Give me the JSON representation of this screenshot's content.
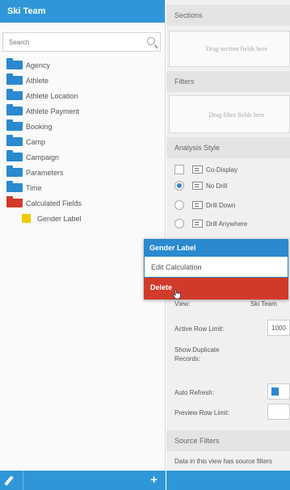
{
  "left_panel": {
    "title": "Ski Team",
    "search_placeholder": "Search",
    "tree": [
      {
        "label": "Agency",
        "kind": "folder"
      },
      {
        "label": "Athlete",
        "kind": "folder"
      },
      {
        "label": "Athlete Location",
        "kind": "folder"
      },
      {
        "label": "Athlete Payment",
        "kind": "folder"
      },
      {
        "label": "Booking",
        "kind": "folder"
      },
      {
        "label": "Camp",
        "kind": "folder"
      },
      {
        "label": "Campaign",
        "kind": "folder"
      },
      {
        "label": "Parameters",
        "kind": "folder"
      },
      {
        "label": "Time",
        "kind": "folder"
      },
      {
        "label": "Calculated Fields",
        "kind": "folder-red"
      },
      {
        "label": "Gender Label",
        "kind": "field"
      }
    ],
    "footer_plus": "+"
  },
  "right_panel": {
    "sections_header": "Sections",
    "sections_drop": "Drag section fields here",
    "filters_header": "Filters",
    "filters_drop": "Drag filter fields here",
    "analysis_header": "Analysis Style",
    "analysis_options": [
      {
        "label": "Co-Display",
        "type": "checkbox"
      },
      {
        "label": "No Drill",
        "type": "radio",
        "selected": true
      },
      {
        "label": "Drill Down",
        "type": "radio"
      },
      {
        "label": "Drill Anywhere",
        "type": "radio"
      }
    ],
    "view_label": "View:",
    "view_value": "Ski Team",
    "active_row_limit_label": "Active Row Limit:",
    "active_row_limit_value": "1000",
    "show_duplicate_label": "Show Duplicate Records:",
    "auto_refresh_label": "Auto Refresh:",
    "preview_row_limit_label": "Preview Row Limit:",
    "source_filters_header": "Source Filters",
    "source_filters_text": "Data in this view has source filters"
  },
  "context_menu": {
    "title": "Gender Label",
    "edit_label": "Edit Calculation",
    "delete_label": "Delete"
  },
  "colors": {
    "accent": "#2f97d7",
    "folder": "#2a89cf",
    "danger": "#d13a2b",
    "field": "#f1cc00"
  }
}
